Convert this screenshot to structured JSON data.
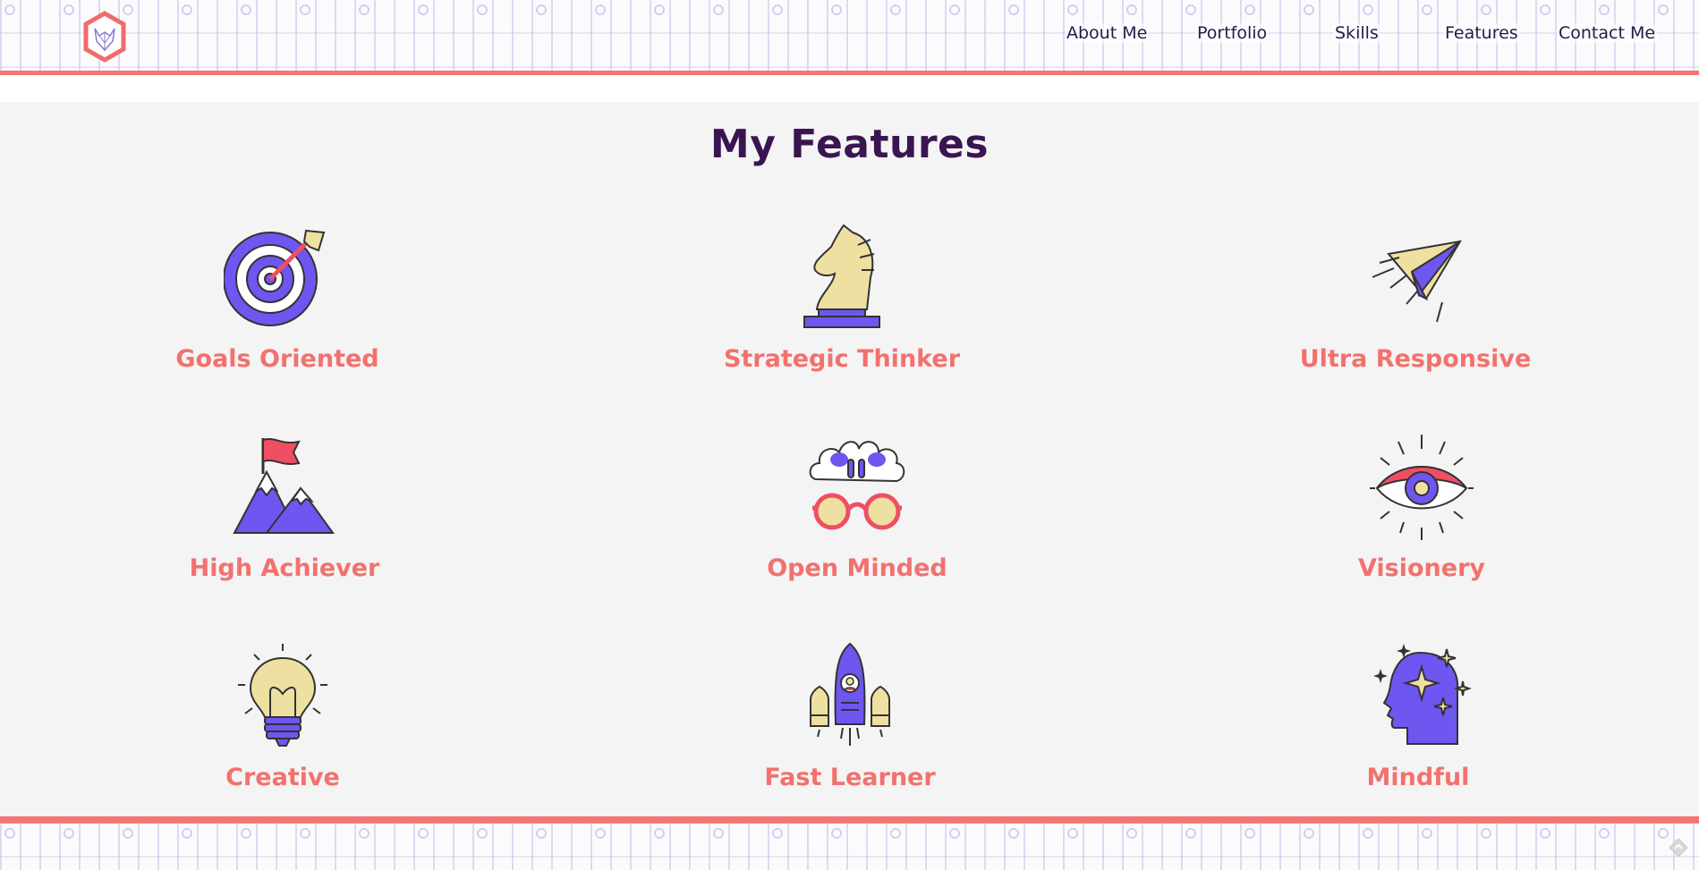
{
  "nav": {
    "items": [
      {
        "label": "About Me"
      },
      {
        "label": "Portfolio"
      },
      {
        "label": "Skills"
      },
      {
        "label": "Features"
      },
      {
        "label": "Contact Me"
      }
    ]
  },
  "features": {
    "title": "My Features",
    "items": [
      {
        "label": "Goals Oriented",
        "icon": "target-arrow-icon"
      },
      {
        "label": "Strategic Thinker",
        "icon": "chess-knight-icon"
      },
      {
        "label": "Ultra Responsive",
        "icon": "paper-plane-icon"
      },
      {
        "label": "High Achiever",
        "icon": "mountain-flag-icon"
      },
      {
        "label": "Open Minded",
        "icon": "brain-glasses-icon"
      },
      {
        "label": "Visionery",
        "icon": "eye-icon"
      },
      {
        "label": "Creative",
        "icon": "lightbulb-icon"
      },
      {
        "label": "Fast Learner",
        "icon": "rocket-icon"
      },
      {
        "label": "Mindful",
        "icon": "head-sparkles-icon"
      }
    ]
  },
  "colors": {
    "accent": "#f57474",
    "heading": "#3a1552",
    "icon_purple": "#6e56f0",
    "icon_cream": "#eee0a0",
    "icon_red": "#ef4f63",
    "label": "#f2716e"
  }
}
